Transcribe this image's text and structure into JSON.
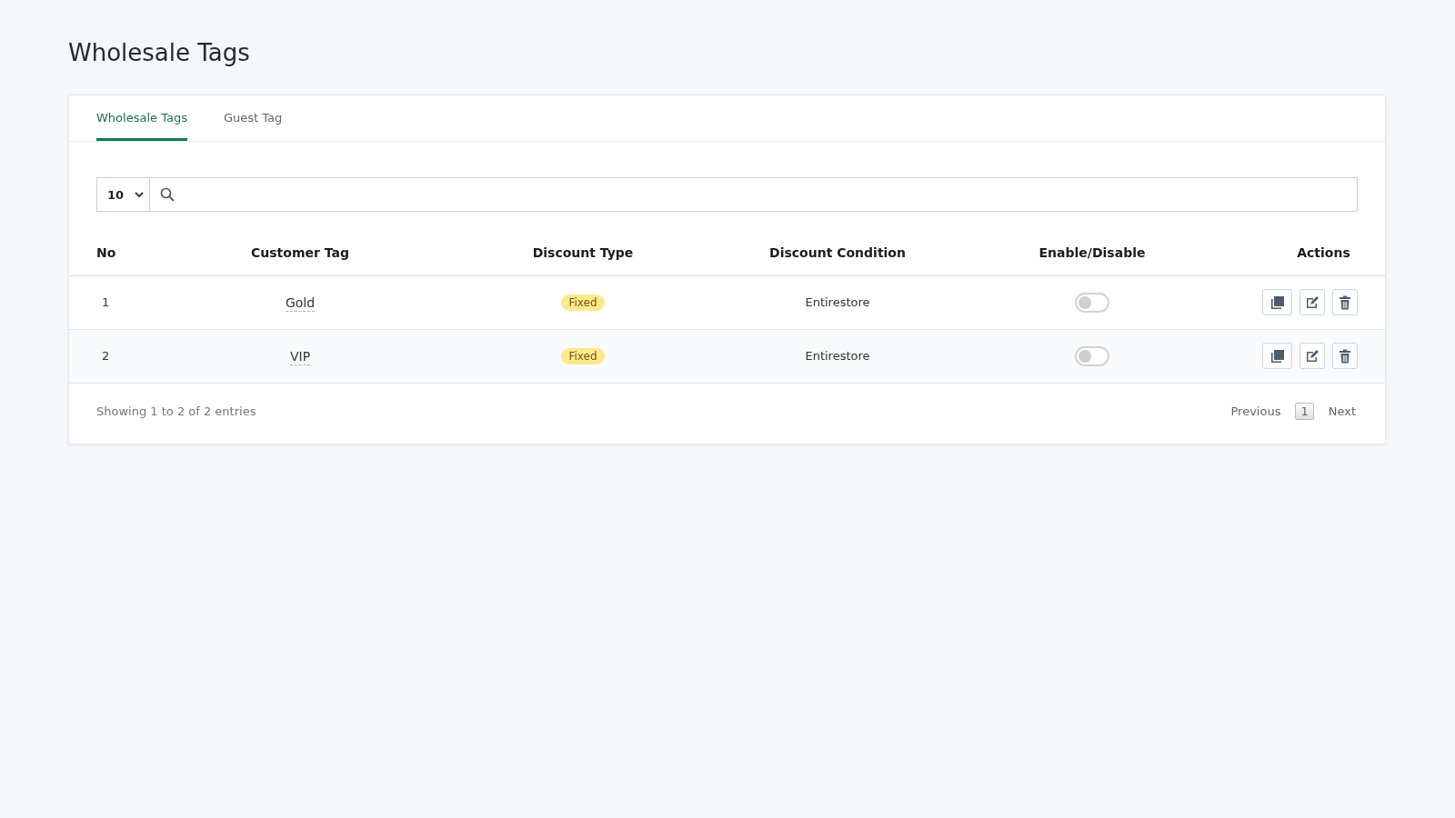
{
  "page_title": "Wholesale Tags",
  "tabs": [
    {
      "label": "Wholesale Tags",
      "selected": true
    },
    {
      "label": "Guest Tag",
      "selected": false
    }
  ],
  "page_length": "10",
  "table": {
    "columns": [
      "No",
      "Customer Tag",
      "Discount Type",
      "Discount Condition",
      "Enable/Disable",
      "Actions"
    ],
    "rows": [
      {
        "no": "1",
        "tag": "Gold",
        "discount_type": "Fixed",
        "condition": "Entirestore",
        "enabled": false
      },
      {
        "no": "2",
        "tag": "VIP",
        "discount_type": "Fixed",
        "condition": "Entirestore",
        "enabled": false
      }
    ]
  },
  "footer": {
    "info": "Showing 1 to 2 of 2 entries",
    "previous": "Previous",
    "pages": [
      {
        "label": "1",
        "selected": true
      }
    ],
    "next": "Next"
  }
}
